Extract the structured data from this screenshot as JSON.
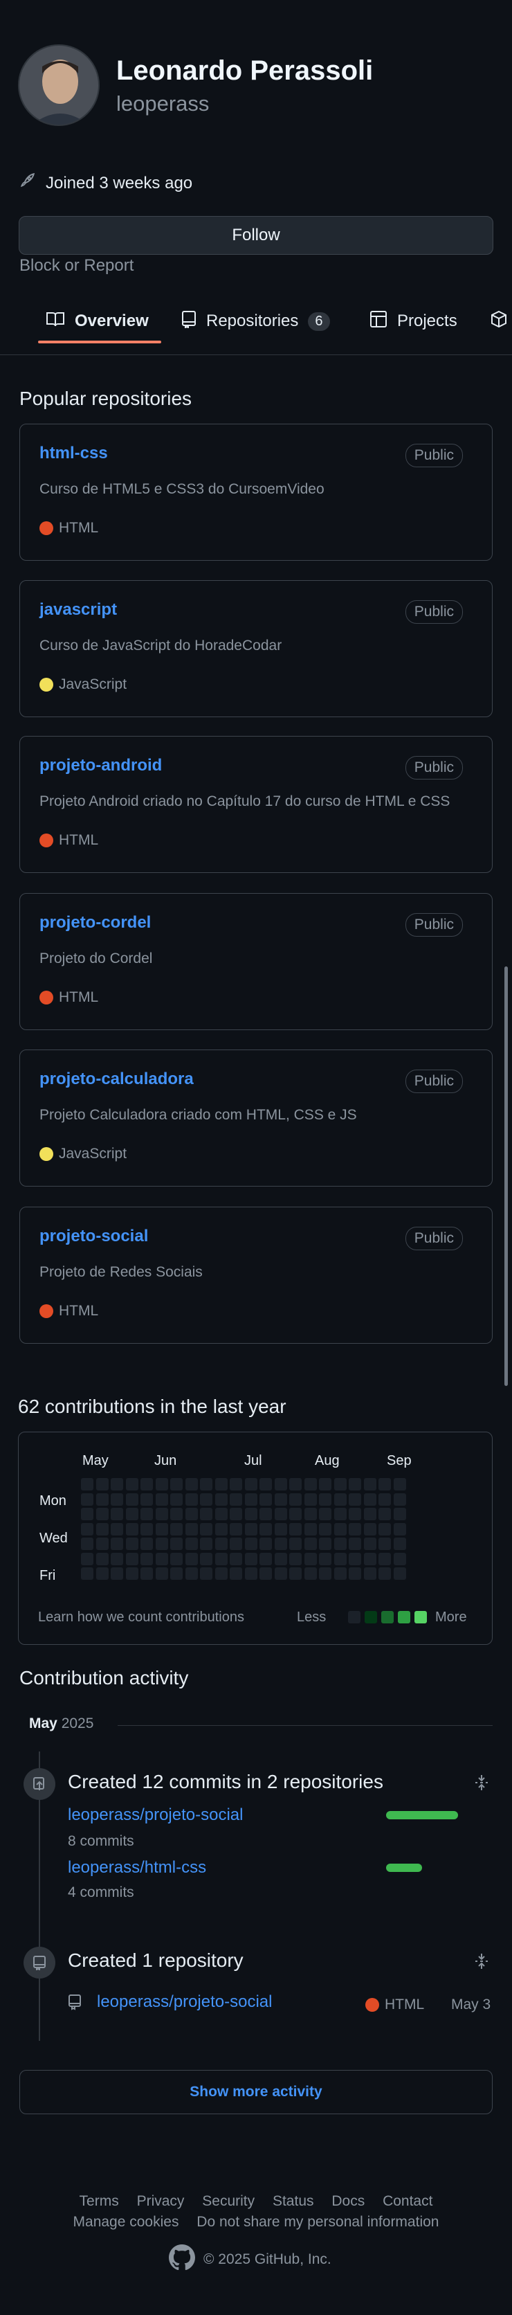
{
  "profile": {
    "name": "Leonardo Perassoli",
    "login": "leoperass",
    "joined": "Joined 3 weeks ago",
    "follow_label": "Follow",
    "block_label": "Block or Report"
  },
  "tabs": [
    {
      "label": "Overview"
    },
    {
      "label": "Repositories",
      "count": "6"
    },
    {
      "label": "Projects"
    }
  ],
  "popular": {
    "heading": "Popular repositories",
    "repos": [
      {
        "name": "html-css",
        "badge": "Public",
        "desc": "Curso de HTML5 e CSS3 do CursoemVideo",
        "lang": "HTML",
        "lang_color": "#e34c26"
      },
      {
        "name": "javascript",
        "badge": "Public",
        "desc": "Curso de JavaScript do HoradeCodar",
        "lang": "JavaScript",
        "lang_color": "#f1e05a"
      },
      {
        "name": "projeto-android",
        "badge": "Public",
        "desc": "Projeto Android criado no Capítulo 17 do curso de HTML e CSS",
        "lang": "HTML",
        "lang_color": "#e34c26"
      },
      {
        "name": "projeto-cordel",
        "badge": "Public",
        "desc": "Projeto do Cordel",
        "lang": "HTML",
        "lang_color": "#e34c26"
      },
      {
        "name": "projeto-calculadora",
        "badge": "Public",
        "desc": "Projeto Calculadora criado com HTML, CSS e JS",
        "lang": "JavaScript",
        "lang_color": "#f1e05a"
      },
      {
        "name": "projeto-social",
        "badge": "Public",
        "desc": "Projeto de Redes Sociais",
        "lang": "HTML",
        "lang_color": "#e34c26"
      }
    ]
  },
  "contributions": {
    "heading": "62 contributions in the last year",
    "months": [
      "May",
      "Jun",
      "Jul",
      "Aug",
      "Sep"
    ],
    "days": [
      "Mon",
      "Wed",
      "Fri"
    ],
    "learn_link": "Learn how we count contributions",
    "less": "Less",
    "more": "More",
    "legend_colors": [
      "#1b2129",
      "#033a16",
      "#196c2e",
      "#2ea043",
      "#56d364"
    ]
  },
  "activity": {
    "heading": "Contribution activity",
    "period_month": "May",
    "period_year": "2025",
    "commits": {
      "title": "Created 12 commits in 2 repositories",
      "repos": [
        {
          "name": "leoperass/projeto-social",
          "count": "8 commits",
          "share": 1.0
        },
        {
          "name": "leoperass/html-css",
          "count": "4 commits",
          "share": 0.5
        }
      ]
    },
    "created": {
      "title": "Created 1 repository",
      "repo": "leoperass/projeto-social",
      "lang": "HTML",
      "lang_color": "#e34c26",
      "date": "May 3"
    },
    "show_more": "Show more activity"
  },
  "footer": {
    "row1": [
      "Terms",
      "Privacy",
      "Security",
      "Status",
      "Docs",
      "Contact"
    ],
    "row2": [
      "Manage cookies",
      "Do not share my personal information"
    ],
    "copyright": "© 2025 GitHub, Inc."
  },
  "colors": {
    "accent": "#4493f8",
    "tab_underline": "#f78166",
    "bar_green": "#3fb950"
  }
}
